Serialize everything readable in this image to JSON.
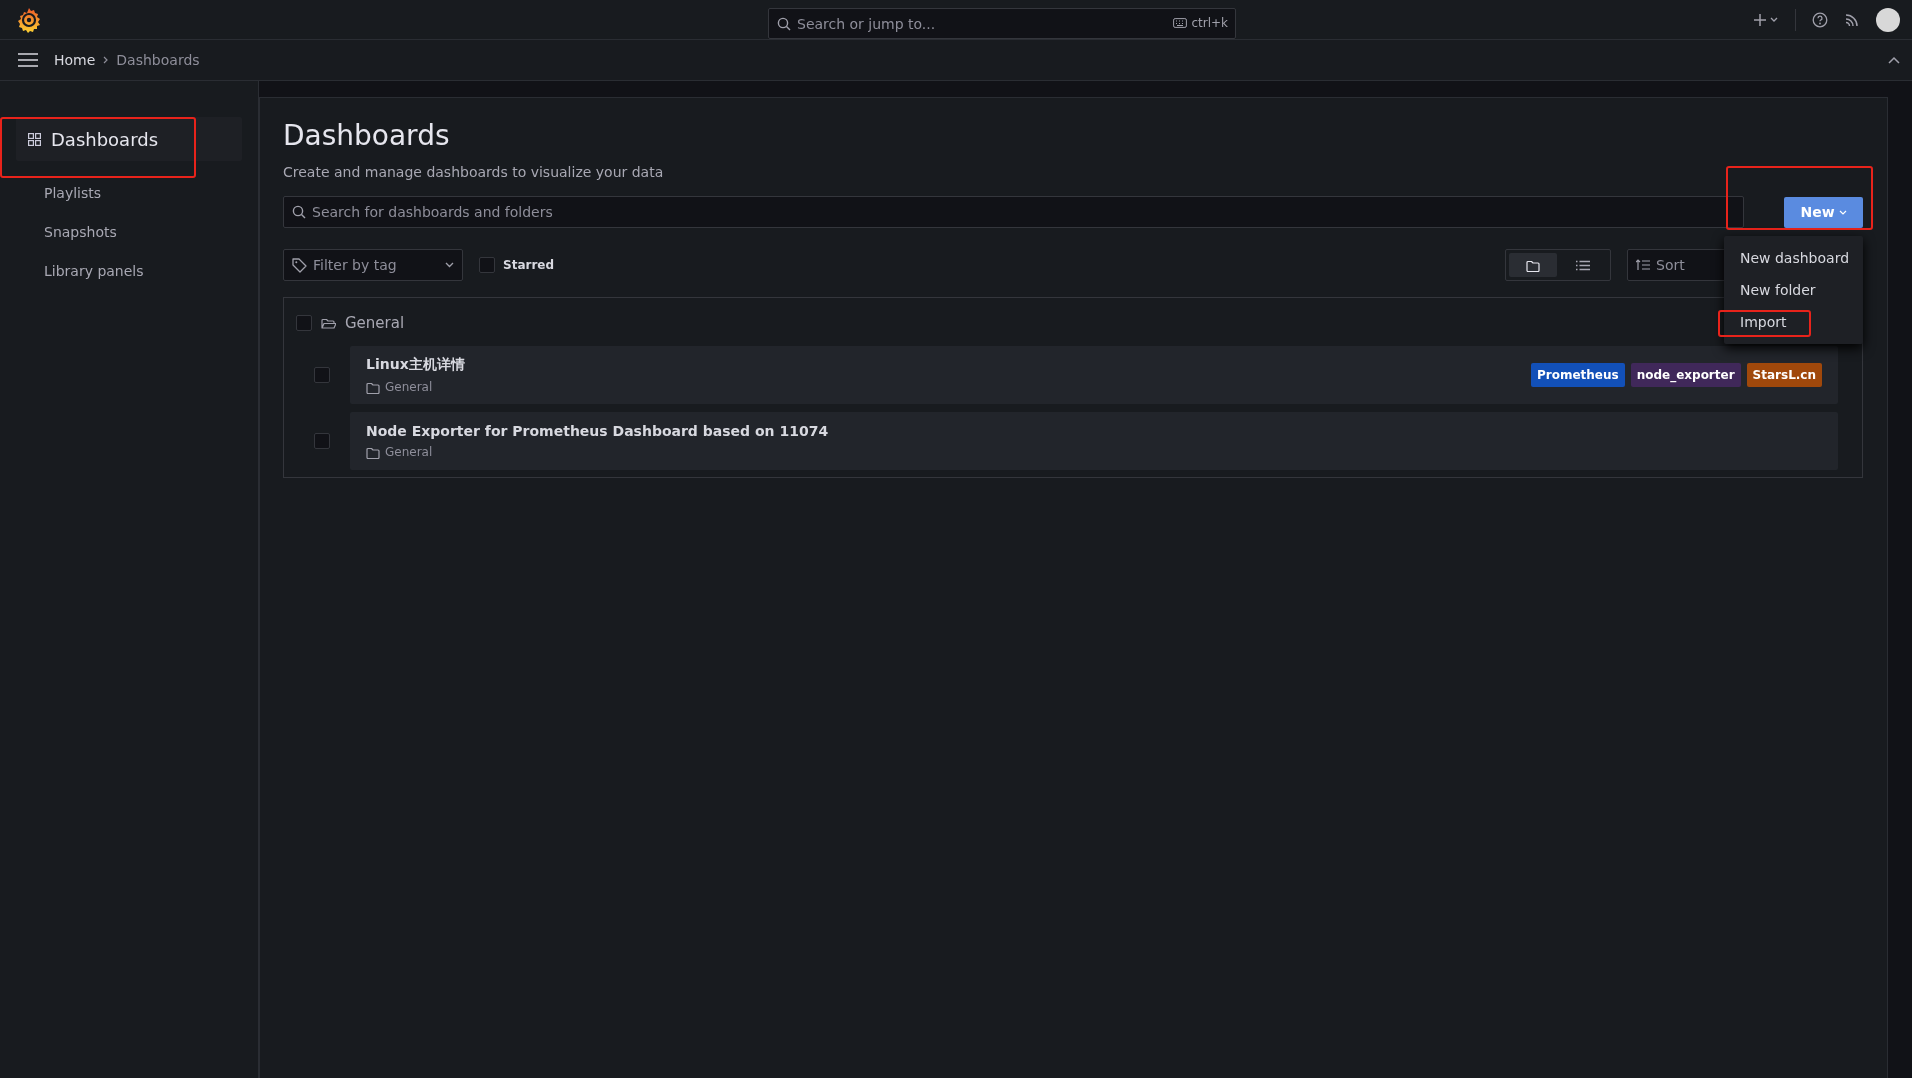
{
  "topbar": {
    "search": {
      "placeholder": "Search or jump to...",
      "shortcut": "ctrl+k"
    }
  },
  "breadcrumbs": [
    {
      "label": "Home",
      "current": false
    },
    {
      "label": "Dashboards",
      "current": true
    }
  ],
  "sidebar": {
    "items": [
      {
        "label": "Dashboards",
        "selected": true,
        "highlighted": true
      },
      {
        "label": "Playlists",
        "selected": false,
        "highlighted": false
      },
      {
        "label": "Snapshots",
        "selected": false,
        "highlighted": false
      },
      {
        "label": "Library panels",
        "selected": false,
        "highlighted": false
      }
    ]
  },
  "page": {
    "title": "Dashboards",
    "subtitle": "Create and manage dashboards to visualize your data"
  },
  "search": {
    "placeholder": "Search for dashboards and folders"
  },
  "new_button": {
    "label": "New",
    "highlighted": true
  },
  "new_menu": [
    {
      "label": "New dashboard",
      "highlighted": false
    },
    {
      "label": "New folder",
      "highlighted": false
    },
    {
      "label": "Import",
      "highlighted": true
    }
  ],
  "filter": {
    "placeholder": "Filter by tag"
  },
  "starred": {
    "label": "Starred",
    "checked": false
  },
  "view_modes": [
    {
      "kind": "folders",
      "selected": true
    },
    {
      "kind": "list",
      "selected": false
    }
  ],
  "sort": {
    "placeholder": "Sort"
  },
  "folders": [
    {
      "name": "General",
      "checked": false,
      "expanded": true,
      "dashboards": [
        {
          "title": "Linux主机详情",
          "checked": false,
          "folder": "General",
          "tags": [
            {
              "label": "Prometheus",
              "color": "#1250b8"
            },
            {
              "label": "node_exporter",
              "color": "#40285a"
            },
            {
              "label": "StarsL.cn",
              "color": "#a0480b"
            }
          ]
        },
        {
          "title": "Node Exporter for Prometheus Dashboard based on 11074",
          "checked": false,
          "folder": "General"
        }
      ]
    }
  ]
}
